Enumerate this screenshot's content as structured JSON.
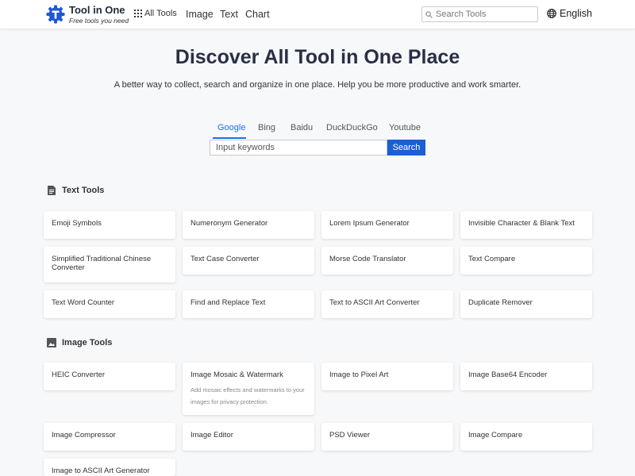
{
  "header": {
    "brand_name": "Tool in One",
    "brand_tagline": "Free tools you need",
    "all_tools_label": "All Tools",
    "nav": [
      {
        "label": "Image"
      },
      {
        "label": "Text"
      },
      {
        "label": "Chart"
      }
    ],
    "search_placeholder": "Search Tools",
    "language": "English"
  },
  "hero": {
    "title": "Discover All Tool in One Place",
    "subtitle": "A better way to collect, search and organize in one place. Help you be more productive and work smarter."
  },
  "engine_search": {
    "engines": [
      {
        "label": "Google",
        "active": true
      },
      {
        "label": "Bing",
        "active": false
      },
      {
        "label": "Baidu",
        "active": false
      },
      {
        "label": "DuckDuckGo",
        "active": false
      },
      {
        "label": "Youtube",
        "active": false
      }
    ],
    "input_placeholder": "Input keywords",
    "button_label": "Search"
  },
  "sections": [
    {
      "title": "Text Tools",
      "icon": "document-icon",
      "tools": [
        {
          "title": "Emoji Symbols"
        },
        {
          "title": "Numeronym Generator"
        },
        {
          "title": "Lorem Ipsum Generator"
        },
        {
          "title": "Invisible Character & Blank Text"
        },
        {
          "title": "Simplified Traditional Chinese Converter"
        },
        {
          "title": "Text Case Converter"
        },
        {
          "title": "Morse Code Translator"
        },
        {
          "title": "Text Compare"
        },
        {
          "title": "Text Word Counter"
        },
        {
          "title": "Find and Replace Text"
        },
        {
          "title": "Text to ASCII Art Converter"
        },
        {
          "title": "Duplicate Remover"
        }
      ]
    },
    {
      "title": "Image Tools",
      "icon": "image-icon",
      "tools": [
        {
          "title": "HEIC Converter"
        },
        {
          "title": "Image Mosaic & Watermark",
          "description": "Add mosaic effects and watermarks to your images for privacy protection."
        },
        {
          "title": "Image to Pixel Art"
        },
        {
          "title": "Image Base64 Encoder"
        },
        {
          "title": "Image Compressor"
        },
        {
          "title": "Image Editor"
        },
        {
          "title": "PSD Viewer"
        },
        {
          "title": "Image Compare"
        },
        {
          "title": "Image to ASCII Art Generator"
        }
      ]
    }
  ],
  "colors": {
    "accent": "#1a73e8",
    "button": "#1a5fd6",
    "title": "#2b2f45",
    "background": "#f7f8fa"
  }
}
